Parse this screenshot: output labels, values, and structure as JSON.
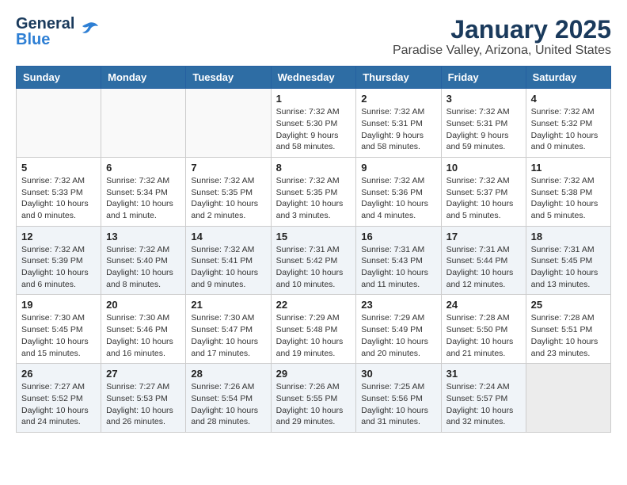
{
  "header": {
    "logo_general": "General",
    "logo_blue": "Blue",
    "title": "January 2025",
    "subtitle": "Paradise Valley, Arizona, United States"
  },
  "days_of_week": [
    "Sunday",
    "Monday",
    "Tuesday",
    "Wednesday",
    "Thursday",
    "Friday",
    "Saturday"
  ],
  "weeks": [
    {
      "shaded": false,
      "days": [
        {
          "num": "",
          "empty": true,
          "data": ""
        },
        {
          "num": "",
          "empty": true,
          "data": ""
        },
        {
          "num": "",
          "empty": true,
          "data": ""
        },
        {
          "num": "1",
          "empty": false,
          "data": "Sunrise: 7:32 AM\nSunset: 5:30 PM\nDaylight: 9 hours and 58 minutes."
        },
        {
          "num": "2",
          "empty": false,
          "data": "Sunrise: 7:32 AM\nSunset: 5:31 PM\nDaylight: 9 hours and 58 minutes."
        },
        {
          "num": "3",
          "empty": false,
          "data": "Sunrise: 7:32 AM\nSunset: 5:31 PM\nDaylight: 9 hours and 59 minutes."
        },
        {
          "num": "4",
          "empty": false,
          "data": "Sunrise: 7:32 AM\nSunset: 5:32 PM\nDaylight: 10 hours and 0 minutes."
        }
      ]
    },
    {
      "shaded": false,
      "days": [
        {
          "num": "5",
          "empty": false,
          "data": "Sunrise: 7:32 AM\nSunset: 5:33 PM\nDaylight: 10 hours and 0 minutes."
        },
        {
          "num": "6",
          "empty": false,
          "data": "Sunrise: 7:32 AM\nSunset: 5:34 PM\nDaylight: 10 hours and 1 minute."
        },
        {
          "num": "7",
          "empty": false,
          "data": "Sunrise: 7:32 AM\nSunset: 5:35 PM\nDaylight: 10 hours and 2 minutes."
        },
        {
          "num": "8",
          "empty": false,
          "data": "Sunrise: 7:32 AM\nSunset: 5:35 PM\nDaylight: 10 hours and 3 minutes."
        },
        {
          "num": "9",
          "empty": false,
          "data": "Sunrise: 7:32 AM\nSunset: 5:36 PM\nDaylight: 10 hours and 4 minutes."
        },
        {
          "num": "10",
          "empty": false,
          "data": "Sunrise: 7:32 AM\nSunset: 5:37 PM\nDaylight: 10 hours and 5 minutes."
        },
        {
          "num": "11",
          "empty": false,
          "data": "Sunrise: 7:32 AM\nSunset: 5:38 PM\nDaylight: 10 hours and 5 minutes."
        }
      ]
    },
    {
      "shaded": true,
      "days": [
        {
          "num": "12",
          "empty": false,
          "data": "Sunrise: 7:32 AM\nSunset: 5:39 PM\nDaylight: 10 hours and 6 minutes."
        },
        {
          "num": "13",
          "empty": false,
          "data": "Sunrise: 7:32 AM\nSunset: 5:40 PM\nDaylight: 10 hours and 8 minutes."
        },
        {
          "num": "14",
          "empty": false,
          "data": "Sunrise: 7:32 AM\nSunset: 5:41 PM\nDaylight: 10 hours and 9 minutes."
        },
        {
          "num": "15",
          "empty": false,
          "data": "Sunrise: 7:31 AM\nSunset: 5:42 PM\nDaylight: 10 hours and 10 minutes."
        },
        {
          "num": "16",
          "empty": false,
          "data": "Sunrise: 7:31 AM\nSunset: 5:43 PM\nDaylight: 10 hours and 11 minutes."
        },
        {
          "num": "17",
          "empty": false,
          "data": "Sunrise: 7:31 AM\nSunset: 5:44 PM\nDaylight: 10 hours and 12 minutes."
        },
        {
          "num": "18",
          "empty": false,
          "data": "Sunrise: 7:31 AM\nSunset: 5:45 PM\nDaylight: 10 hours and 13 minutes."
        }
      ]
    },
    {
      "shaded": false,
      "days": [
        {
          "num": "19",
          "empty": false,
          "data": "Sunrise: 7:30 AM\nSunset: 5:45 PM\nDaylight: 10 hours and 15 minutes."
        },
        {
          "num": "20",
          "empty": false,
          "data": "Sunrise: 7:30 AM\nSunset: 5:46 PM\nDaylight: 10 hours and 16 minutes."
        },
        {
          "num": "21",
          "empty": false,
          "data": "Sunrise: 7:30 AM\nSunset: 5:47 PM\nDaylight: 10 hours and 17 minutes."
        },
        {
          "num": "22",
          "empty": false,
          "data": "Sunrise: 7:29 AM\nSunset: 5:48 PM\nDaylight: 10 hours and 19 minutes."
        },
        {
          "num": "23",
          "empty": false,
          "data": "Sunrise: 7:29 AM\nSunset: 5:49 PM\nDaylight: 10 hours and 20 minutes."
        },
        {
          "num": "24",
          "empty": false,
          "data": "Sunrise: 7:28 AM\nSunset: 5:50 PM\nDaylight: 10 hours and 21 minutes."
        },
        {
          "num": "25",
          "empty": false,
          "data": "Sunrise: 7:28 AM\nSunset: 5:51 PM\nDaylight: 10 hours and 23 minutes."
        }
      ]
    },
    {
      "shaded": true,
      "days": [
        {
          "num": "26",
          "empty": false,
          "data": "Sunrise: 7:27 AM\nSunset: 5:52 PM\nDaylight: 10 hours and 24 minutes."
        },
        {
          "num": "27",
          "empty": false,
          "data": "Sunrise: 7:27 AM\nSunset: 5:53 PM\nDaylight: 10 hours and 26 minutes."
        },
        {
          "num": "28",
          "empty": false,
          "data": "Sunrise: 7:26 AM\nSunset: 5:54 PM\nDaylight: 10 hours and 28 minutes."
        },
        {
          "num": "29",
          "empty": false,
          "data": "Sunrise: 7:26 AM\nSunset: 5:55 PM\nDaylight: 10 hours and 29 minutes."
        },
        {
          "num": "30",
          "empty": false,
          "data": "Sunrise: 7:25 AM\nSunset: 5:56 PM\nDaylight: 10 hours and 31 minutes."
        },
        {
          "num": "31",
          "empty": false,
          "data": "Sunrise: 7:24 AM\nSunset: 5:57 PM\nDaylight: 10 hours and 32 minutes."
        },
        {
          "num": "",
          "empty": true,
          "data": ""
        }
      ]
    }
  ]
}
